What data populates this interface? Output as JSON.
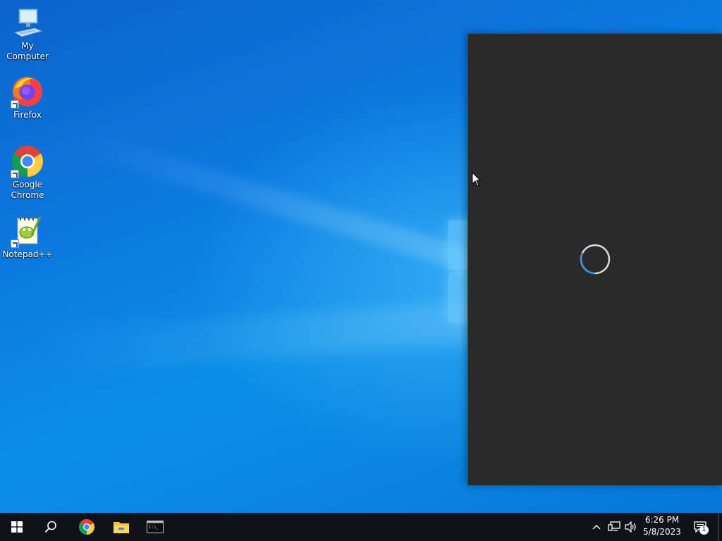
{
  "desktop": {
    "icons": [
      {
        "label": "My Computer",
        "icon": "computer-icon"
      },
      {
        "label": "Firefox",
        "icon": "firefox-icon"
      },
      {
        "label": "Google Chrome",
        "icon": "chrome-icon"
      },
      {
        "label": "Notepad++",
        "icon": "notepadpp-icon"
      }
    ]
  },
  "panel": {
    "state": "loading",
    "background": "#2b2a2a",
    "spinner_color": "#3a8de0"
  },
  "taskbar": {
    "pinned": [
      "start-icon",
      "search-icon",
      "chrome-icon",
      "file-explorer-icon",
      "terminal-icon"
    ],
    "tray": {
      "time": "6:26 PM",
      "date": "5/8/2023",
      "notification_count": "1"
    }
  },
  "colors": {
    "accent": "#0a78d7",
    "taskbar": "#111217"
  }
}
